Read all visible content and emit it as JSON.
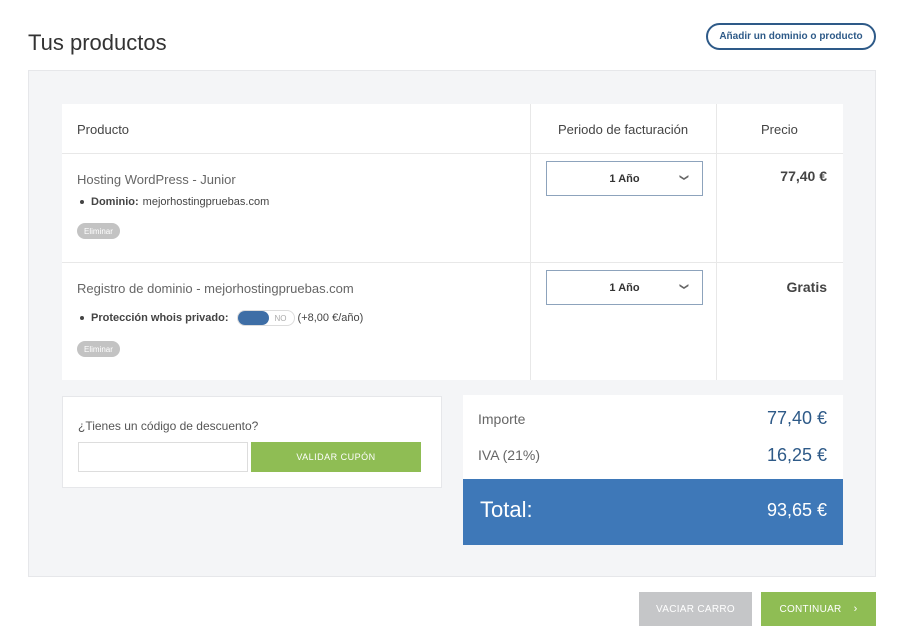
{
  "page": {
    "title": "Tus productos",
    "add_button_label": "Añadir un dominio o producto"
  },
  "table": {
    "headers": {
      "product": "Producto",
      "billing": "Periodo de facturación",
      "price": "Precio"
    },
    "rows": [
      {
        "name": "Hosting WordPress - Junior",
        "detail_label": "Dominio:",
        "detail_value": "mejorhostingpruebas.com",
        "remove_label": "Eliminar",
        "period": "1 Año",
        "price": "77,40 €"
      },
      {
        "name": "Registro de dominio - mejorhostingpruebas.com",
        "detail_label": "Protección whois privado:",
        "toggle_state": "NO",
        "toggle_price": "(+8,00 €/año)",
        "remove_label": "Eliminar",
        "period": "1 Año",
        "price": "Gratis"
      }
    ]
  },
  "coupon": {
    "question": "¿Tienes un código de descuento?",
    "input_value": "",
    "button_label": "VALIDAR CUPÓN"
  },
  "totals": {
    "subtotal_label": "Importe",
    "subtotal_value": "77,40 €",
    "tax_label": "IVA (21%)",
    "tax_value": "16,25 €",
    "total_label": "Total:",
    "total_value": "93,65 €"
  },
  "actions": {
    "empty_label": "VACIAR CARRO",
    "continue_label": "CONTINUAR"
  },
  "colors": {
    "accent_green": "#8fbd54",
    "accent_blue": "#3e78b8",
    "dark_blue": "#2e5a88"
  }
}
